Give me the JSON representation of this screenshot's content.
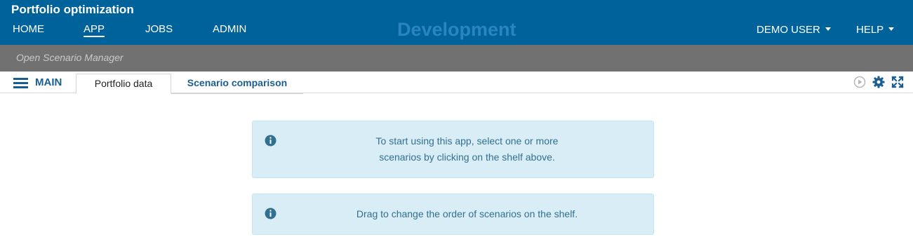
{
  "header": {
    "app_title": "Portfolio optimization",
    "environment": "Development",
    "nav": [
      "HOME",
      "APP",
      "JOBS",
      "ADMIN"
    ],
    "active_nav": "APP",
    "user_menu": "DEMO USER",
    "help_menu": "HELP",
    "background_color": "#00629b"
  },
  "scenario_manager": {
    "label": "Open Scenario Manager"
  },
  "tabs": {
    "menu_label": "MAIN",
    "items": [
      "Portfolio data",
      "Scenario comparison"
    ],
    "active": "Portfolio data",
    "icons": [
      "play-circle-icon",
      "gear-icon",
      "fullscreen-icon"
    ]
  },
  "messages": [
    {
      "line1": "To start using this app, select one or more",
      "line2": "scenarios by clicking on the shelf above."
    },
    {
      "line1": "Drag to change the order of scenarios on the shelf."
    }
  ],
  "colors": {
    "info_bg": "#d9edf7",
    "info_text": "#31708f",
    "accent": "#1a5e91"
  }
}
